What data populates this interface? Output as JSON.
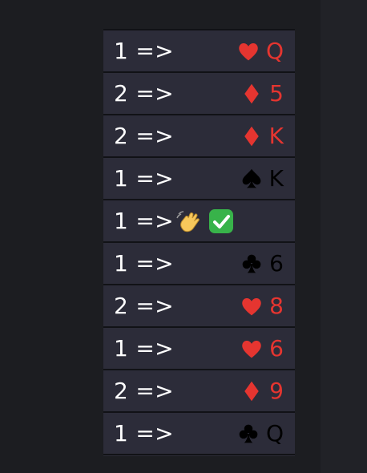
{
  "rows": [
    {
      "count": "1 =>",
      "suit": "heart",
      "rank": "Q",
      "color": "red"
    },
    {
      "count": "2 =>",
      "suit": "diamond",
      "rank": "5",
      "color": "red"
    },
    {
      "count": "2 =>",
      "suit": "diamond",
      "rank": "K",
      "color": "red"
    },
    {
      "count": "1 =>",
      "suit": "spade",
      "rank": "K",
      "color": "black"
    },
    {
      "count": "1 =>",
      "special": "wave-check"
    },
    {
      "count": "1 =>",
      "suit": "club",
      "rank": "6",
      "color": "black"
    },
    {
      "count": "2 =>",
      "suit": "heart",
      "rank": "8",
      "color": "red"
    },
    {
      "count": "1 =>",
      "suit": "heart",
      "rank": "6",
      "color": "red"
    },
    {
      "count": "2 =>",
      "suit": "diamond",
      "rank": "9",
      "color": "red"
    },
    {
      "count": "1 =>",
      "suit": "club",
      "rank": "Q",
      "color": "black"
    }
  ],
  "colors": {
    "red": "#e53530",
    "black": "#000000",
    "row_bg": "#2c2c39",
    "page_bg": "#1c1d21"
  },
  "icons": {
    "heart": "heart-icon",
    "diamond": "diamond-icon",
    "spade": "spade-icon",
    "club": "club-icon",
    "wave": "waving-hand-icon",
    "check": "check-mark-button-icon"
  }
}
